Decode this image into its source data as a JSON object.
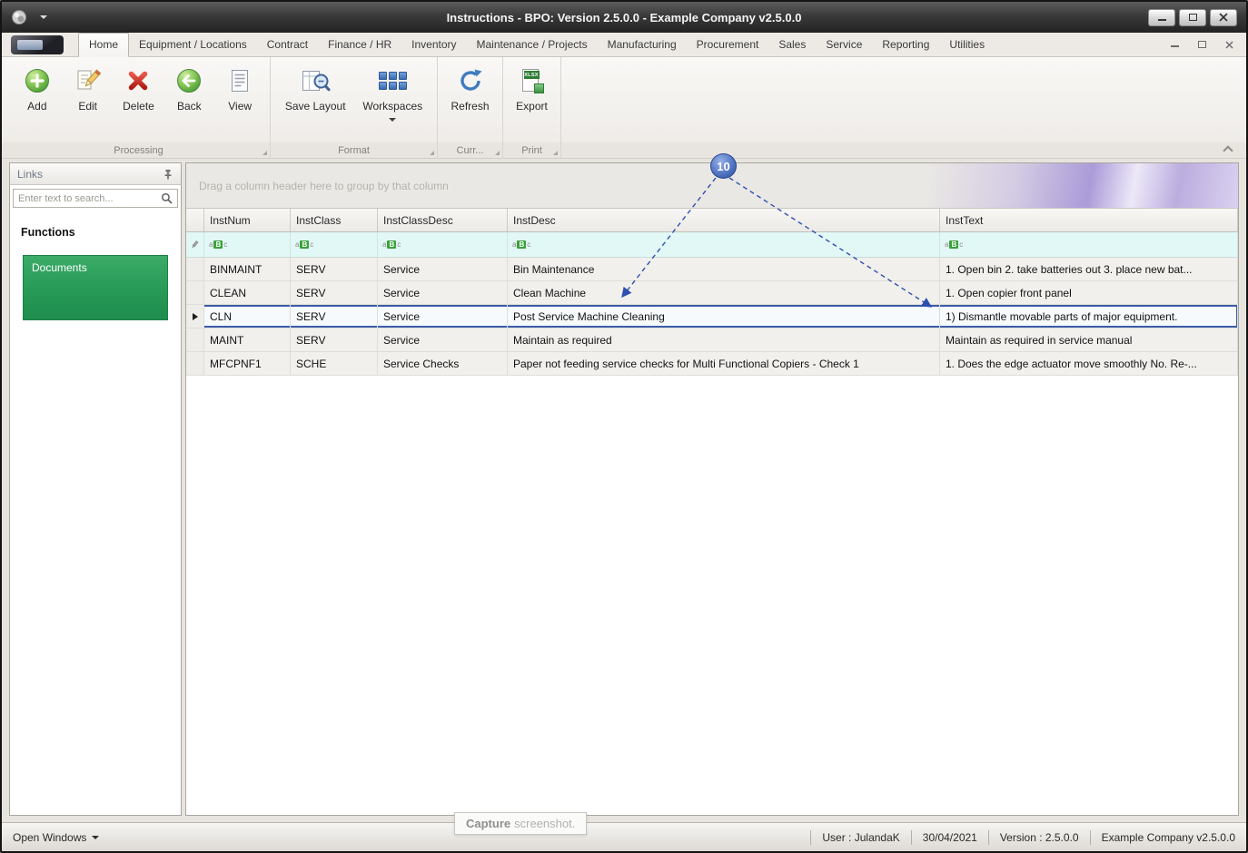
{
  "window": {
    "title": "Instructions - BPO: Version 2.5.0.0 - Example Company v2.5.0.0"
  },
  "ribbon": {
    "tabs": [
      {
        "label": "Home"
      },
      {
        "label": "Equipment / Locations"
      },
      {
        "label": "Contract"
      },
      {
        "label": "Finance / HR"
      },
      {
        "label": "Inventory"
      },
      {
        "label": "Maintenance / Projects"
      },
      {
        "label": "Manufacturing"
      },
      {
        "label": "Procurement"
      },
      {
        "label": "Sales"
      },
      {
        "label": "Service"
      },
      {
        "label": "Reporting"
      },
      {
        "label": "Utilities"
      }
    ],
    "buttons": [
      {
        "label": "Add"
      },
      {
        "label": "Edit"
      },
      {
        "label": "Delete"
      },
      {
        "label": "Back"
      },
      {
        "label": "View"
      },
      {
        "label": "Save Layout"
      },
      {
        "label": "Workspaces"
      },
      {
        "label": "Refresh"
      },
      {
        "label": "Export"
      }
    ],
    "groups": [
      {
        "label": "Processing"
      },
      {
        "label": "Format"
      },
      {
        "label": "Curr..."
      },
      {
        "label": "Print"
      }
    ]
  },
  "sidebar": {
    "title": "Links",
    "search_placeholder": "Enter text to search...",
    "section_label": "Functions",
    "tiles": [
      {
        "label": "Documents"
      }
    ]
  },
  "grid": {
    "group_hint": "Drag a column header here to group by that column",
    "columns": [
      "InstNum",
      "InstClass",
      "InstClassDesc",
      "InstDesc",
      "InstText"
    ],
    "rows": [
      [
        "BINMAINT",
        "SERV",
        "Service",
        "Bin Maintenance",
        "1. Open bin 2. take batteries out 3. place new bat..."
      ],
      [
        "CLEAN",
        "SERV",
        "Service",
        "Clean Machine",
        "1. Open copier front panel"
      ],
      [
        "CLN",
        "SERV",
        "Service",
        "Post Service Machine Cleaning",
        "1)  Dismantle movable parts of major equipment."
      ],
      [
        "MAINT",
        "SERV",
        "Service",
        "Maintain as required",
        "Maintain as required in service manual"
      ],
      [
        "MFCPNF1",
        "SCHE",
        "Service Checks",
        "Paper not feeding service checks for Multi Functional Copiers - Check 1",
        "1. Does the edge actuator move smoothly No. Re-..."
      ]
    ],
    "selected_row": "CLN"
  },
  "annotation": {
    "label": "10"
  },
  "statusbar": {
    "open_windows_label": "Open Windows",
    "capture_bold": "Capture",
    "capture_rest": "screenshot.",
    "user": "User : JulandaK",
    "date": "30/04/2021",
    "version": "Version : 2.5.0.0",
    "company": "Example Company v2.5.0.0"
  },
  "icons": {
    "filter_a": "a",
    "filter_b": "B",
    "filter_c": "c",
    "xlsx_label": "XLSX"
  }
}
